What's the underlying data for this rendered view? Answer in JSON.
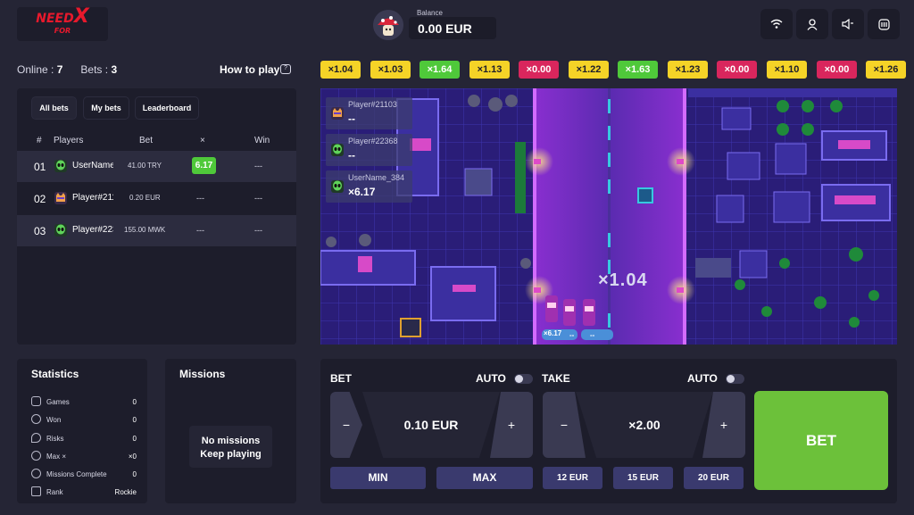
{
  "header": {
    "logo_top": "NEED",
    "logo_mid": "FOR",
    "logo_x": "X",
    "balance_label": "Balance",
    "balance_value": "0.00 EUR",
    "icons": [
      "wifi-icon",
      "user-icon",
      "sound-icon",
      "fairness-icon"
    ]
  },
  "status": {
    "online_label": "Online :",
    "online_value": "7",
    "bets_label": "Bets :",
    "bets_value": "3",
    "how_to_play": "How to play"
  },
  "bets_panel": {
    "tabs": [
      "All bets",
      "My bets",
      "Leaderboard"
    ],
    "columns": [
      "#",
      "Players",
      "Bet",
      "×",
      "Win"
    ],
    "rows": [
      {
        "num": "01",
        "name": "UserName_384",
        "bet": "41.00 TRY",
        "mult": "6.17",
        "win": "---"
      },
      {
        "num": "02",
        "name": "Player#21103",
        "bet": "0.20 EUR",
        "mult": "---",
        "win": "---"
      },
      {
        "num": "03",
        "name": "Player#22368",
        "bet": "155.00 MWK",
        "mult": "---",
        "win": "---"
      }
    ]
  },
  "statistics": {
    "title": "Statistics",
    "items": [
      {
        "label": "Games",
        "value": "0",
        "icon": "gamepad-icon"
      },
      {
        "label": "Won",
        "value": "0",
        "icon": "trophy-icon"
      },
      {
        "label": "Risks",
        "value": "0",
        "icon": "flame-icon"
      },
      {
        "label": "Max ×",
        "value": "×0",
        "icon": "gauge-icon"
      },
      {
        "label": "Missions Complete",
        "value": "0",
        "icon": "check-icon"
      },
      {
        "label": "Rank",
        "value": "Rockie",
        "icon": "badge-icon"
      }
    ]
  },
  "missions": {
    "title": "Missions",
    "empty_line1": "No missions",
    "empty_line2": "Keep playing"
  },
  "multiplier_history": [
    {
      "value": "×1.04",
      "color": "#f5d327",
      "text": "#1d1d2b"
    },
    {
      "value": "×1.03",
      "color": "#f5d327",
      "text": "#1d1d2b"
    },
    {
      "value": "×1.64",
      "color": "#4fc93a",
      "text": "#ffffff"
    },
    {
      "value": "×1.13",
      "color": "#f5d327",
      "text": "#1d1d2b"
    },
    {
      "value": "×0.00",
      "color": "#d9265d",
      "text": "#ffffff"
    },
    {
      "value": "×1.22",
      "color": "#f5d327",
      "text": "#1d1d2b"
    },
    {
      "value": "×1.63",
      "color": "#4fc93a",
      "text": "#ffffff"
    },
    {
      "value": "×1.23",
      "color": "#f5d327",
      "text": "#1d1d2b"
    },
    {
      "value": "×0.00",
      "color": "#d9265d",
      "text": "#ffffff"
    },
    {
      "value": "×1.10",
      "color": "#f5d327",
      "text": "#1d1d2b"
    },
    {
      "value": "×0.00",
      "color": "#d9265d",
      "text": "#ffffff"
    },
    {
      "value": "×1.26",
      "color": "#f5d327",
      "text": "#1d1d2b"
    }
  ],
  "game": {
    "current_multiplier": "×1.04",
    "players": [
      {
        "name": "Player#21103",
        "value": "--"
      },
      {
        "name": "Player#22368",
        "value": "--"
      },
      {
        "name": "UserName_384",
        "value": "×6.17"
      }
    ],
    "car_tags": [
      "×6.17",
      "--",
      "--"
    ]
  },
  "controls": {
    "bet_label": "BET",
    "take_label": "TAKE",
    "auto_label": "AUTO",
    "bet_value": "0.10 EUR",
    "take_value": "×2.00",
    "minus": "−",
    "plus": "+",
    "min_label": "MIN",
    "max_label": "MAX",
    "quick_take": [
      "12 EUR",
      "15 EUR",
      "20 EUR"
    ],
    "bet_button": "BET"
  },
  "colors": {
    "background": "#252535",
    "panel": "#1d1d2b",
    "accent_green": "#6cc13a",
    "accent_red": "#e8192c"
  }
}
